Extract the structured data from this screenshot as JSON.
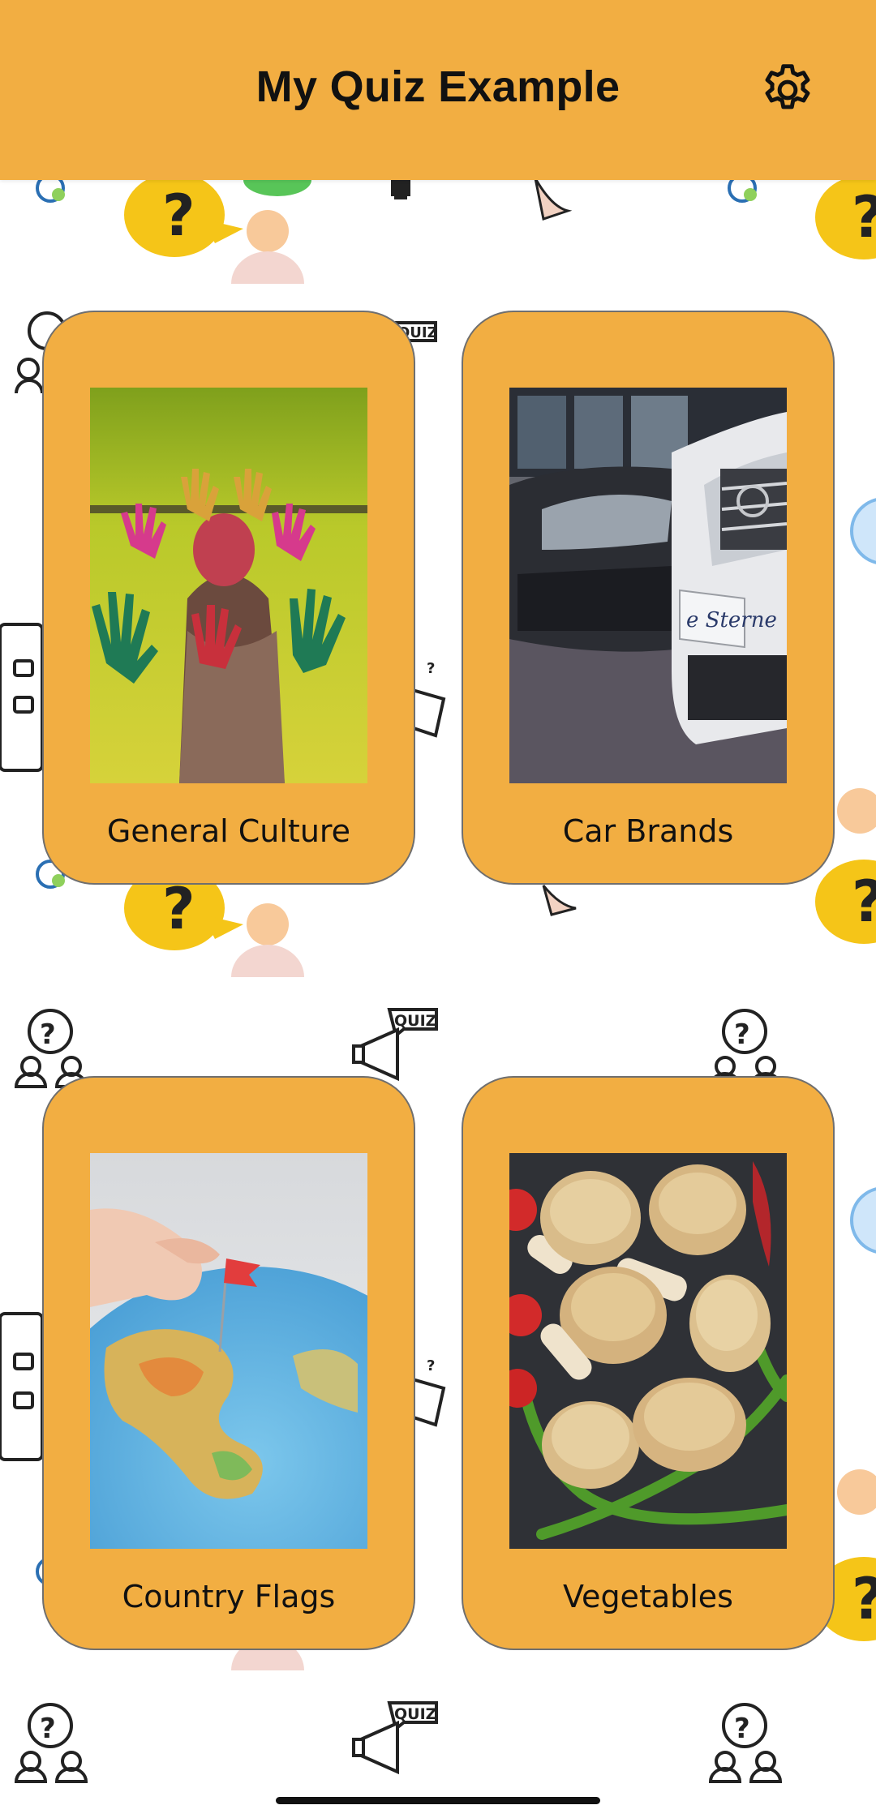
{
  "header": {
    "title": "My Quiz Example",
    "settings_icon": "gear-icon"
  },
  "categories": [
    {
      "label": "General Culture",
      "image": "hands-painted-photo"
    },
    {
      "label": "Car Brands",
      "image": "cars-parked-photo"
    },
    {
      "label": "Country Flags",
      "image": "globe-pin-photo"
    },
    {
      "label": "Vegetables",
      "image": "mushrooms-peppers-photo"
    }
  ],
  "background": {
    "pattern_label": "QUIZ",
    "glyph": "?"
  },
  "colors": {
    "accent": "#F2AE42",
    "background": "#ffffff",
    "text": "#111111"
  }
}
